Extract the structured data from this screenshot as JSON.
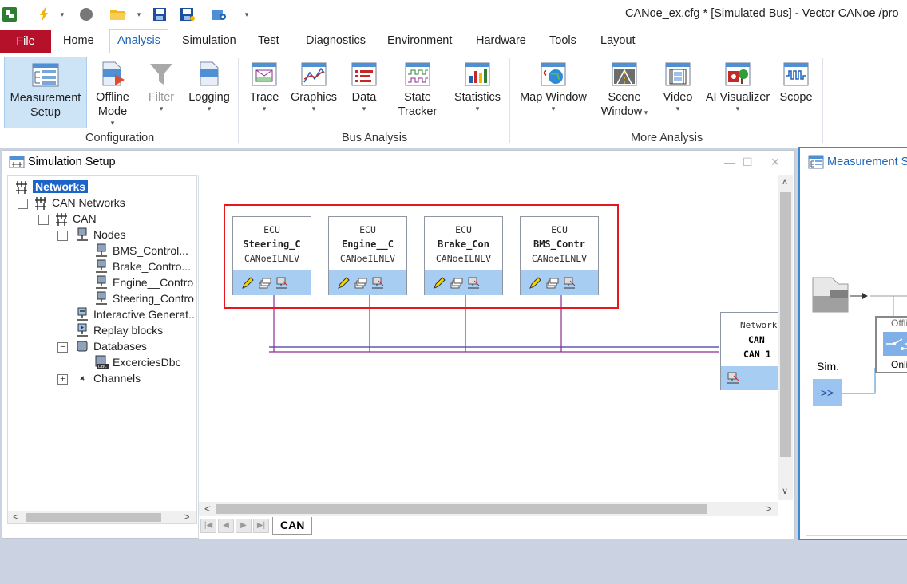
{
  "window": {
    "title": "CANoe_ex.cfg * [Simulated Bus] - Vector CANoe /pro"
  },
  "menu": {
    "file": "File",
    "tabs": [
      "Home",
      "Analysis",
      "Simulation",
      "Test",
      "Diagnostics",
      "Environment",
      "Hardware",
      "Tools",
      "Layout"
    ],
    "active_tab": "Analysis"
  },
  "ribbon": {
    "measurement_setup": [
      "Measurement",
      "Setup"
    ],
    "offline_mode": [
      "Offline",
      "Mode"
    ],
    "filter": "Filter",
    "logging": "Logging",
    "trace": "Trace",
    "graphics": "Graphics",
    "data": "Data",
    "state_tracker": [
      "State",
      "Tracker"
    ],
    "statistics": "Statistics",
    "map_window": "Map Window",
    "scene_window": [
      "Scene",
      "Window"
    ],
    "video": "Video",
    "ai_visualizer": "AI Visualizer",
    "scope": "Scope",
    "groups": {
      "configuration": "Configuration",
      "bus_analysis": "Bus Analysis",
      "more_analysis": "More Analysis"
    }
  },
  "simulation_setup": {
    "title": "Simulation Setup",
    "tree": {
      "networks": "Networks",
      "can_networks": "CAN Networks",
      "can": "CAN",
      "nodes": "Nodes",
      "node_items": [
        "BMS_Control...",
        "Brake_Contro...",
        "Engine__Contro",
        "Steering_Contro"
      ],
      "interactive_generators": "Interactive Generat...",
      "replay_blocks": "Replay blocks",
      "databases": "Databases",
      "database_items": [
        "ExcerciesDbc"
      ],
      "channels": "Channels"
    },
    "ecus": [
      {
        "type": "ECU",
        "name": "Steering_C",
        "layer": "CANoeILNLV"
      },
      {
        "type": "ECU",
        "name": "Engine__C",
        "layer": "CANoeILNLV"
      },
      {
        "type": "ECU",
        "name": "Brake_Con",
        "layer": "CANoeILNLV"
      },
      {
        "type": "ECU",
        "name": "BMS_Contr",
        "layer": "CANoeILNLV"
      }
    ],
    "network_node": {
      "type": "Network",
      "name": "CAN",
      "channel": "CAN 1"
    },
    "sheet_tab": "CAN"
  },
  "measurement_setup": {
    "title": "Measurement Setup",
    "offline_label": "Offline",
    "online_label": "Onlin",
    "sim_label": "Sim.",
    "sim_button": ">>"
  },
  "colors": {
    "file_tab": "#b5112b",
    "accent": "#1e63b8",
    "ecu_bar": "#a8cdf3",
    "highlight": "#e8161d",
    "bus_line": "#8e2a8f"
  }
}
